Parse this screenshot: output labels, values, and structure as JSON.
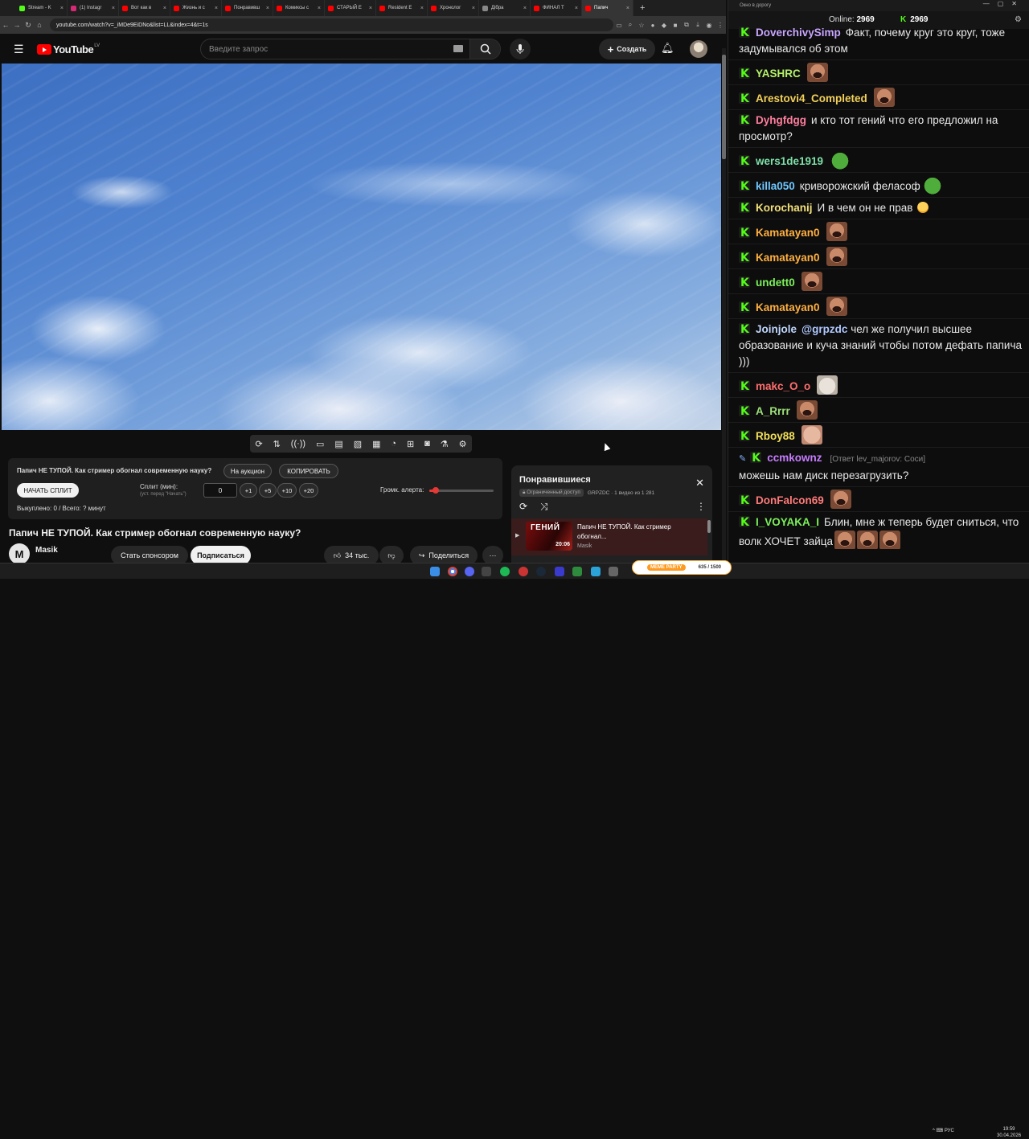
{
  "browser": {
    "tabs": [
      {
        "label": "Stream - K",
        "color": "#53fc18"
      },
      {
        "label": "(1) Instagr",
        "color": "#d62976"
      },
      {
        "label": "Вот как в",
        "color": "#ff0000"
      },
      {
        "label": "Жизнь и с",
        "color": "#ff0000"
      },
      {
        "label": "Понравивш",
        "color": "#ff0000"
      },
      {
        "label": "Комиксы с",
        "color": "#ff0000"
      },
      {
        "label": "СТАРЫЙ Е",
        "color": "#ff0000"
      },
      {
        "label": "Resident E",
        "color": "#ff0000"
      },
      {
        "label": "Хронолог",
        "color": "#ff0000"
      },
      {
        "label": "Дібра",
        "color": "#888888"
      },
      {
        "label": "ФИНАЛ Т",
        "color": "#ff0000"
      },
      {
        "label": "Папич",
        "color": "#ff0000"
      }
    ],
    "url": "youtube.com/watch?v=_iMDe9EiDNo&list=LL&index=4&t=1s"
  },
  "youtube": {
    "logo_text": "YouTube",
    "country_code": "LV",
    "search_placeholder": "Введите запрос",
    "create_label": "Создать"
  },
  "split_panel": {
    "title": "Папич НЕ ТУПОЙ. Как стример обогнал современную науку?",
    "auction_label": "На аукцион",
    "copy_label": "КОПИРОВАТЬ",
    "start_split_label": "НАЧАТЬ СПЛИТ",
    "split_min_label": "Сплит (мин):",
    "split_hint": "(уст. перед \"Начать\")",
    "split_value": "0",
    "step_buttons": [
      "+1",
      "+5",
      "+10",
      "+20"
    ],
    "alert_volume_label": "Громк. алерта:",
    "alert_volume_fraction": 0.1,
    "bought_text": "Выкуплено: 0 / Всего: ? минут"
  },
  "video": {
    "title": "Папич НЕ ТУПОЙ. Как стример обогнал современную науку?",
    "channel_name": "Masik",
    "channel_initial": "M",
    "sponsor_label": "Стать спонсором",
    "subscribe_label": "Подписаться",
    "likes": "34 тыс.",
    "share_label": "Поделиться"
  },
  "playlist": {
    "title": "Понравившиеся",
    "access_badge": "Ограниченный доступ",
    "meta": "GRPZDC · 1 видео из 1 281",
    "item_title": "Папич НЕ ТУПОЙ. Как стример обогнал...",
    "item_channel": "Masik",
    "thumb_text": "ГЕНИЙ",
    "duration": "20:06"
  },
  "chat": {
    "window_title": "Окно в дорогу",
    "online_label": "Online:",
    "online_count": "2969",
    "kick_count": "2969",
    "messages": [
      {
        "user": "DoverchivySimp",
        "color": "#c8a6ff",
        "text": "Факт, почему круг это круг, тоже задумывался об этом"
      },
      {
        "user": "YASHRC",
        "color": "#b6f26a",
        "text": "",
        "emote": "face1"
      },
      {
        "user": "Arestovi4_Completed",
        "color": "#f2d05a",
        "text": "",
        "emote": "face1"
      },
      {
        "user": "Dyhgfdgg",
        "color": "#ff7e9d",
        "text": "и кто тот гений что его предложил на просмотр?"
      },
      {
        "user": "wers1de1919",
        "color": "#7ee0a8",
        "text": "",
        "emote": "frog"
      },
      {
        "user": "killa050",
        "color": "#6fc8ff",
        "text": "криворожский феласоф",
        "emote": "frog"
      },
      {
        "user": "Korochanij",
        "color": "#f2e07a",
        "text": "И в чем он не прав"
      },
      {
        "user": "Kamatayan0",
        "color": "#ffb040",
        "text": "",
        "emote": "face1"
      },
      {
        "user": "Kamatayan0",
        "color": "#ffb040",
        "text": "",
        "emote": "face1"
      },
      {
        "user": "undett0",
        "color": "#7cf05a",
        "text": "",
        "emote": "face1"
      },
      {
        "user": "Kamatayan0",
        "color": "#ffb040",
        "text": "",
        "emote": "face1"
      },
      {
        "user": "Joinjole",
        "color": "#c0d8ff",
        "mention": "@grpzdc",
        "text": "чел же получил высшее образование и куча знаний чтобы потом дефать папича )))"
      },
      {
        "user": "makc_O_o",
        "color": "#ff6e6e",
        "text": "",
        "emote": "cat"
      },
      {
        "user": "A_Rrrr",
        "color": "#9ee07a",
        "text": "",
        "emote": "face1"
      },
      {
        "user": "Rboy88",
        "color": "#f2e05a",
        "text": "",
        "emote": "face2"
      },
      {
        "user": "ccmkownz",
        "color": "#c77dff",
        "reply": "[Ответ lev_majorov: Соси]",
        "text": "можешь нам диск перезагрузить?"
      },
      {
        "user": "DonFalcon69",
        "color": "#ff7a7a",
        "text": "",
        "emote": "face1"
      },
      {
        "user": "I_VOYAKA_I",
        "color": "#7cf05a",
        "text": "Блин, мне ж теперь будет сниться, что волк ХОЧЕТ зайца",
        "emote": "face1x3"
      }
    ]
  },
  "taskbar": {
    "meme_label": "MEME PARTY",
    "meme_count": "635 / 1500",
    "lang": "РУС",
    "time": "19:59",
    "date": "30.04.2026"
  }
}
